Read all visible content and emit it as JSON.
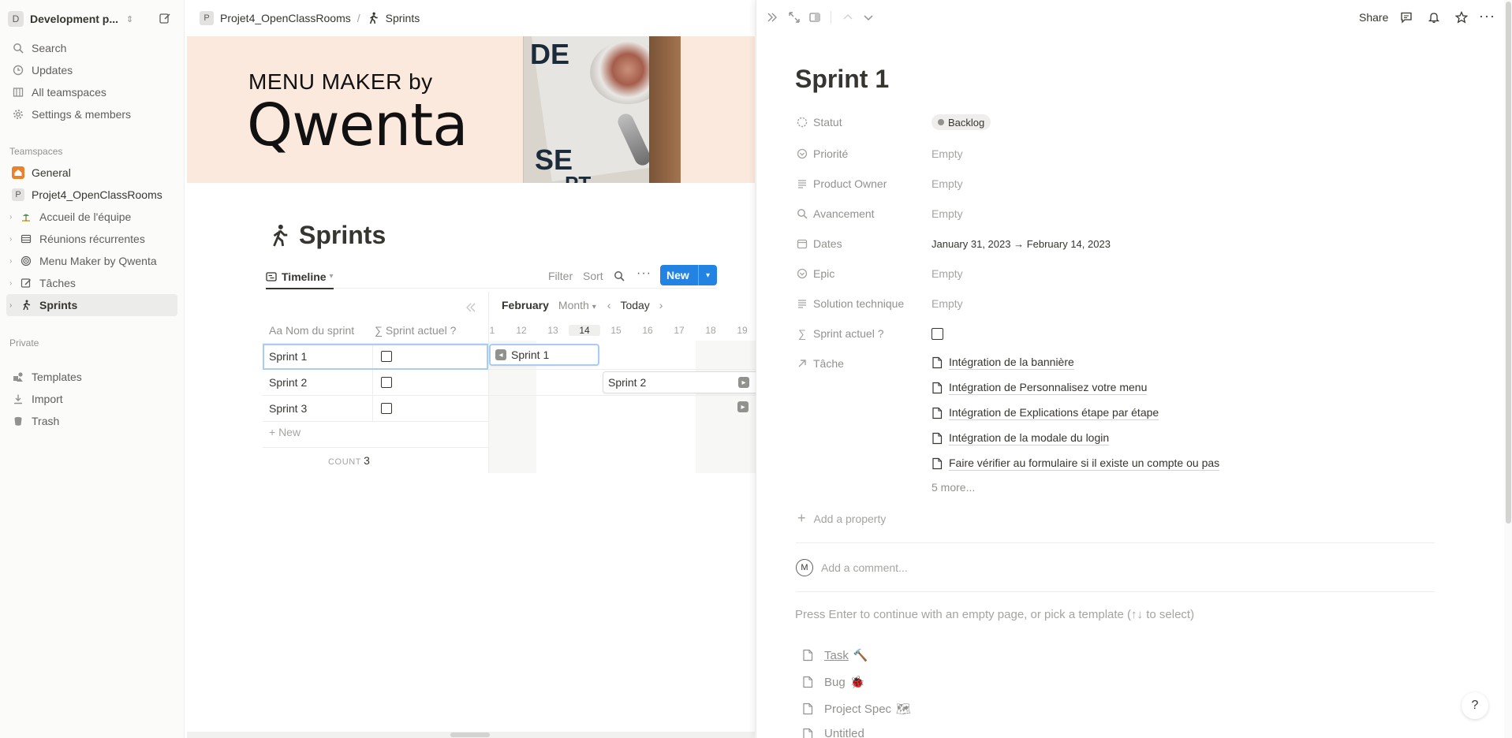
{
  "sidebar": {
    "workspace": {
      "avatar": "D",
      "name": "Development p..."
    },
    "nav": [
      {
        "label": "Search",
        "icon": "search-icon"
      },
      {
        "label": "Updates",
        "icon": "clock-icon"
      },
      {
        "label": "All teamspaces",
        "icon": "grid-icon"
      },
      {
        "label": "Settings & members",
        "icon": "gear-icon"
      }
    ],
    "teamspaces_label": "Teamspaces",
    "teamspaces": [
      {
        "label": "General",
        "icon": "home-icon"
      },
      {
        "label": "Projet4_OpenClassRooms",
        "icon": "p-badge-icon",
        "badge": "P"
      }
    ],
    "pages": [
      {
        "label": "Accueil de l'équipe",
        "icon": "beach-icon"
      },
      {
        "label": "Réunions récurrentes",
        "icon": "table-icon"
      },
      {
        "label": "Menu Maker by Qwenta",
        "icon": "target-icon"
      },
      {
        "label": "Tâches",
        "icon": "checklist-icon"
      },
      {
        "label": "Sprints",
        "icon": "walker-icon"
      }
    ],
    "private_label": "Private",
    "footer": [
      {
        "label": "Templates",
        "icon": "templates-icon"
      },
      {
        "label": "Import",
        "icon": "import-icon"
      },
      {
        "label": "Trash",
        "icon": "trash-icon"
      }
    ]
  },
  "topbar": {
    "crumb1_badge": "P",
    "crumb1": "Projet4_OpenClassRooms",
    "sep": "/",
    "crumb2": "Sprints"
  },
  "banner": {
    "line1": "MENU MAKER by",
    "line2": "Qwenta",
    "photo_text1": "DE",
    "photo_text2": "SE",
    "photo_text3": "PT"
  },
  "page": {
    "title": "Sprints"
  },
  "database": {
    "view_label": "Timeline",
    "filter": "Filter",
    "sort": "Sort",
    "new_label": "New",
    "columns": [
      "Aa Nom du sprint",
      "∑ Sprint actuel ?"
    ],
    "rows": [
      {
        "name": "Sprint 1",
        "checked": false
      },
      {
        "name": "Sprint 2",
        "checked": false
      },
      {
        "name": "Sprint 3",
        "checked": false
      }
    ],
    "add_row": "+ New",
    "count_label": "COUNT",
    "count_value": "3"
  },
  "timeline": {
    "month": "February",
    "scale": "Month",
    "today": "Today",
    "days": [
      "1",
      "12",
      "13",
      "14",
      "15",
      "16",
      "17",
      "18",
      "19"
    ],
    "today_day": "14",
    "bars": [
      {
        "label": "Sprint 1"
      },
      {
        "label": "Sprint 2"
      }
    ]
  },
  "peek": {
    "share": "Share",
    "title": "Sprint 1",
    "properties": [
      {
        "name": "Statut",
        "icon": "status-icon",
        "value": "Backlog",
        "type": "tag"
      },
      {
        "name": "Priorité",
        "icon": "select-icon",
        "value": "Empty",
        "type": "empty"
      },
      {
        "name": "Product Owner",
        "icon": "lines-icon",
        "value": "Empty",
        "type": "empty"
      },
      {
        "name": "Avancement",
        "icon": "search-icon",
        "value": "Empty",
        "type": "empty"
      },
      {
        "name": "Dates",
        "icon": "calendar-icon",
        "value": "January 31, 2023 → February 14, 2023",
        "type": "text"
      },
      {
        "name": "Epic",
        "icon": "select-icon",
        "value": "Empty",
        "type": "empty"
      },
      {
        "name": "Solution technique",
        "icon": "lines-icon",
        "value": "Empty",
        "type": "empty"
      },
      {
        "name": "Sprint actuel ?",
        "icon": "sigma-icon",
        "value": "",
        "type": "checkbox"
      },
      {
        "name": "Tâche",
        "icon": "relation-icon",
        "value": "",
        "type": "relation"
      }
    ],
    "tasks": [
      "Intégration de la bannière",
      "Intégration de Personnalisez votre menu",
      "Intégration de Explications étape par étape",
      "Intégration de la modale du login",
      "Faire vérifier au formulaire si il existe un compte ou pas"
    ],
    "more": "5 more...",
    "add_property": "Add a property",
    "comment_avatar": "M",
    "comment_placeholder": "Add a comment...",
    "hint": "Press Enter to continue with an empty page, or pick a template (↑↓ to select)",
    "templates": [
      {
        "label": "Task",
        "emoji": "🔨"
      },
      {
        "label": "Bug",
        "emoji": "🐞"
      },
      {
        "label": "Project Spec",
        "emoji": "🗺"
      },
      {
        "label": "Untitled",
        "emoji": ""
      }
    ],
    "help": "?"
  }
}
